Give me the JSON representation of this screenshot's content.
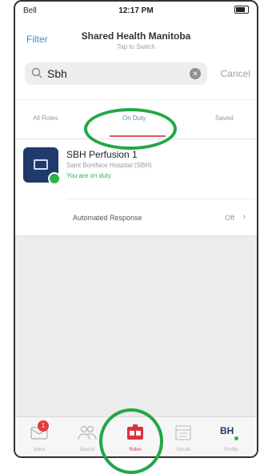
{
  "status_bar": {
    "carrier": "Bell",
    "time": "12:17 PM"
  },
  "nav": {
    "filter_label": "Filter",
    "title": "Shared Health Manitoba",
    "subtitle": "Tap to Switch"
  },
  "search": {
    "value": "Sbh",
    "cancel_label": "Cancel"
  },
  "tabs": [
    {
      "label": "All Roles"
    },
    {
      "label": "On Duty",
      "selected": true
    },
    {
      "label": "Saved"
    }
  ],
  "result": {
    "name": "SBH Perfusion 1",
    "site": "Saint Boniface Hospital (SBH)",
    "status": "You are on duty",
    "automated_response_label": "Automated Response",
    "automated_response_value": "Off"
  },
  "tabbar": [
    {
      "label": "Inbox",
      "badge": "1",
      "icon": "inbox-icon"
    },
    {
      "label": "Search",
      "icon": "people-icon"
    },
    {
      "label": "Roles",
      "icon": "roles-icon",
      "active": true
    },
    {
      "label": "Oncall",
      "icon": "calendar-icon"
    },
    {
      "label": "Profile",
      "initials": "BH"
    }
  ],
  "colors": {
    "accent": "#3a8ed8",
    "active_tab": "#d9323c",
    "online": "#2cb34a",
    "avatar_bg": "#1f3a6b",
    "highlight_ring": "#22a845"
  }
}
